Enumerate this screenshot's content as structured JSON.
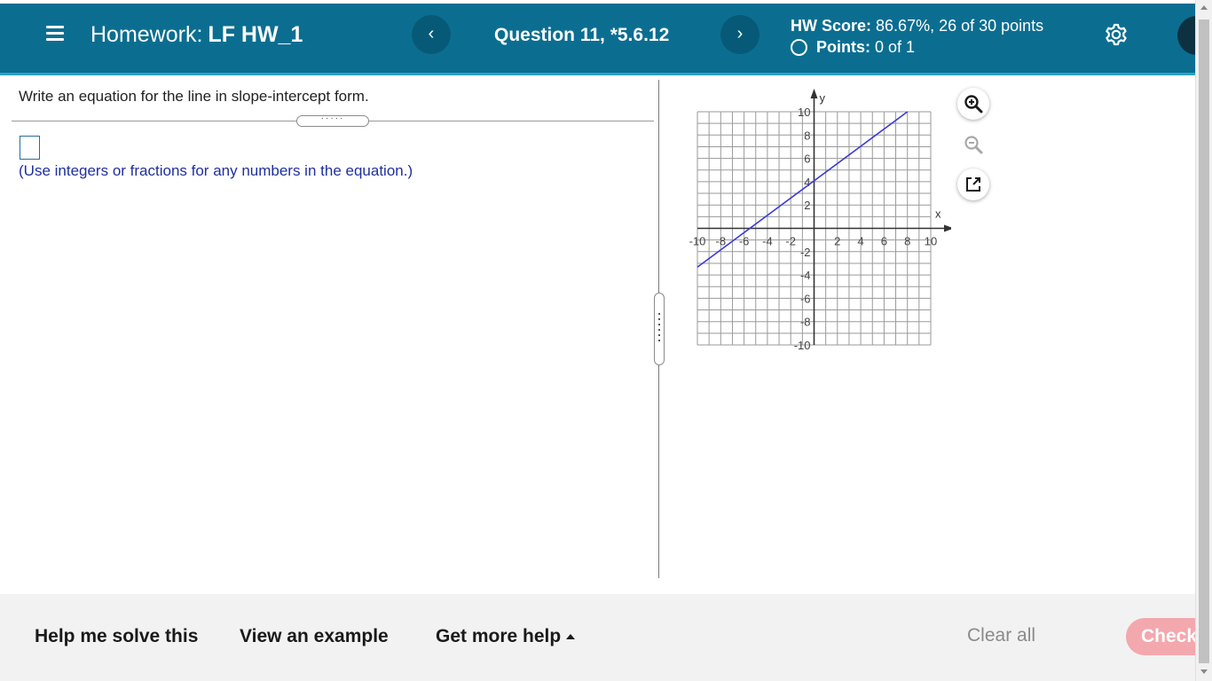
{
  "header": {
    "homework_label": "Homework:",
    "homework_name": "LF HW_1",
    "prev_label": "‹",
    "next_label": "›",
    "question_title": "Question 11, *5.6.12",
    "hw_score_label": "HW Score:",
    "hw_score_value": "86.67%, 26 of 30 points",
    "points_label": "Points:",
    "points_value": "0 of 1"
  },
  "question": {
    "prompt": "Write an equation for the line in slope-intercept form.",
    "answer_value": "",
    "hint": "(Use integers or fractions for any numbers in the equation.)"
  },
  "graph": {
    "x_axis_label": "x",
    "y_axis_label": "y",
    "x_range": [
      -10,
      10
    ],
    "y_range": [
      -10,
      10
    ],
    "grid_step": 1,
    "tick_label_step": 2,
    "line_color": "#3a3ad8",
    "line_points": [
      [
        -10,
        -3.33
      ],
      [
        8,
        10
      ]
    ],
    "x_tick_labels": [
      "-10",
      "-8",
      "-6",
      "-4",
      "-2",
      "2",
      "4",
      "6",
      "8",
      "10"
    ],
    "y_tick_labels": [
      "10",
      "8",
      "6",
      "4",
      "2",
      "-2",
      "-4",
      "-6",
      "-8",
      "-10"
    ]
  },
  "tools": {
    "zoom_in_icon": "zoom-in-icon",
    "zoom_out_icon": "zoom-out-icon",
    "popout_icon": "external-link-icon"
  },
  "footer": {
    "help_solve": "Help me solve this",
    "view_example": "View an example",
    "more_help": "Get more help",
    "clear_all": "Clear all",
    "check": "Check"
  },
  "colors": {
    "header_bg": "#0b6e91",
    "hint_text": "#1f2fa0",
    "check_button": "#f3a8ae"
  }
}
